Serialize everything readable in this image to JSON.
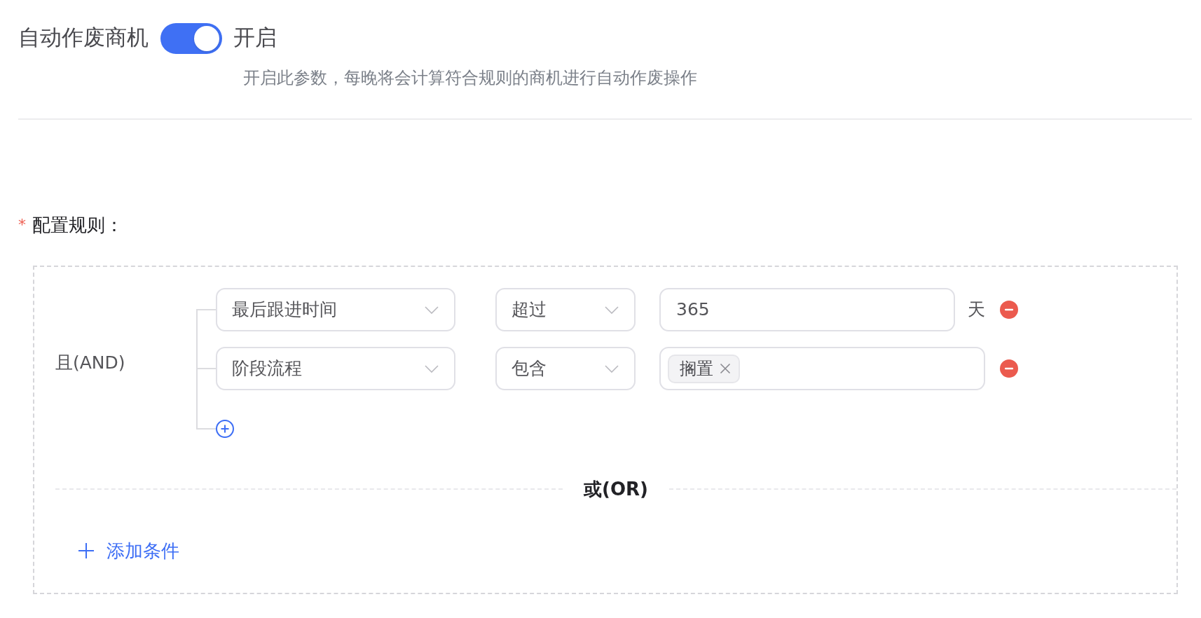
{
  "auto_void": {
    "label": "自动作废商机",
    "enabled": true,
    "status": "开启",
    "description": "开启此参数，每晚将会计算符合规则的商机进行自动作废操作"
  },
  "rules": {
    "required_mark": "*",
    "label": "配置规则：",
    "groups": [
      {
        "logic": "且(AND)",
        "conditions": [
          {
            "kind": "number",
            "field": "最后跟进时间",
            "operator": "超过",
            "value": "365",
            "unit": "天"
          },
          {
            "kind": "tags",
            "field": "阶段流程",
            "operator": "包含",
            "tags": [
              "搁置"
            ]
          }
        ]
      }
    ],
    "or_label": "或(OR)",
    "add_condition": "添加条件"
  }
}
